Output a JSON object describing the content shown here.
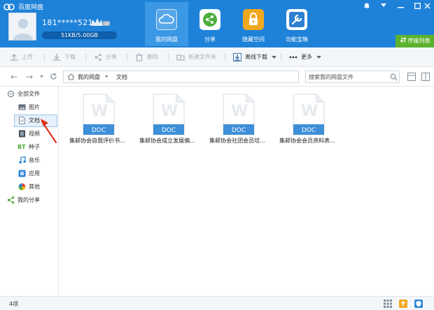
{
  "app": {
    "title": "百度网盘"
  },
  "user": {
    "username": "181*****521",
    "quota_text": "51KB/5.00GB",
    "quota_used_fraction": 0.0
  },
  "nav_tabs": [
    {
      "label": "我的网盘",
      "icon": "cloud-icon",
      "active": true
    },
    {
      "label": "分享",
      "icon": "share-icon",
      "active": false
    },
    {
      "label": "隐藏空间",
      "icon": "lock-icon",
      "active": false
    },
    {
      "label": "功能宝箱",
      "icon": "wrench-icon",
      "active": false
    }
  ],
  "transfer_list_label": "传输列表",
  "toolbar": {
    "upload": "上传",
    "download": "下载",
    "share": "分享",
    "delete": "删除",
    "new_folder": "新建文件夹",
    "offline_download": "离线下载",
    "more": "更多"
  },
  "breadcrumb": [
    "我的网盘",
    "文档"
  ],
  "search": {
    "placeholder": "搜索我的网盘文件"
  },
  "sidebar": {
    "all_files": "全部文件",
    "items": [
      {
        "label": "图片",
        "icon": "image-icon"
      },
      {
        "label": "文档",
        "icon": "document-icon",
        "selected": true
      },
      {
        "label": "视频",
        "icon": "video-icon"
      },
      {
        "label": "种子",
        "icon": "bt-icon",
        "icon_text": "BT"
      },
      {
        "label": "音乐",
        "icon": "music-icon"
      },
      {
        "label": "应用",
        "icon": "app-icon"
      },
      {
        "label": "其他",
        "icon": "other-icon"
      }
    ],
    "my_share": "我的分享"
  },
  "files": [
    {
      "name": "集邮协会自我评价书...",
      "type_label": "DOC",
      "glyph": "W"
    },
    {
      "name": "集邮协会成立发展偏...",
      "type_label": "DOC",
      "glyph": "W"
    },
    {
      "name": "集邮协会社团会员培...",
      "type_label": "DOC",
      "glyph": "W"
    },
    {
      "name": "集邮协会会员资料表...",
      "type_label": "DOC",
      "glyph": "W"
    }
  ],
  "status": {
    "count": "4项"
  },
  "colors": {
    "header_blue": "#1e82d9",
    "active_tab": "#3b98e5",
    "transfer_green": "#5cb22e",
    "doc_blue": "#3d8fd8",
    "arrow_red": "#e0311f"
  }
}
